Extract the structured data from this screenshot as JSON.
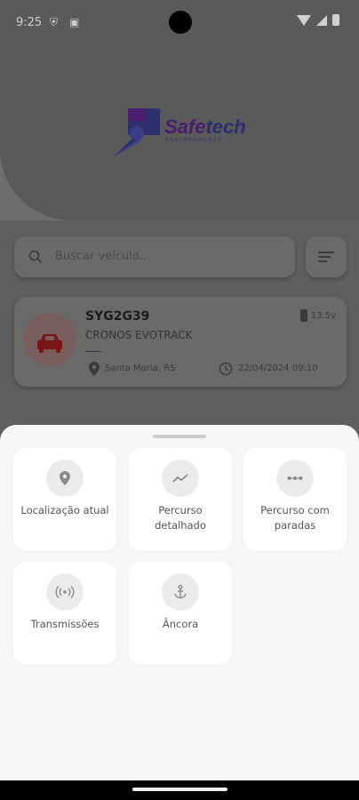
{
  "status_bar": {
    "time": "9:25"
  },
  "brand": {
    "name_part1": "Safe",
    "name_part2": "tech",
    "tagline": "RASTREAMENTO"
  },
  "search": {
    "placeholder": "Buscar veículo..."
  },
  "vehicle": {
    "plate": "SYG2G39",
    "model": "CRONOS EVOTRACK",
    "battery": "13.5v",
    "location": "Santa Maria, RS",
    "datetime": "22/04/2024 09:10"
  },
  "actions": [
    {
      "label": "Localização atual",
      "icon": "location-pin-icon"
    },
    {
      "label": "Percurso detalhado",
      "icon": "route-trend-icon"
    },
    {
      "label": "Percurso com paradas",
      "icon": "route-stops-icon"
    },
    {
      "label": "Transmissões",
      "icon": "broadcast-icon"
    },
    {
      "label": "Âncora",
      "icon": "anchor-icon"
    }
  ],
  "colors": {
    "brand_blue": "#2d2f6e",
    "brand_purple": "#4a1d6e",
    "car_red": "#7a1515",
    "sheet_bg": "#f6f6f6"
  }
}
